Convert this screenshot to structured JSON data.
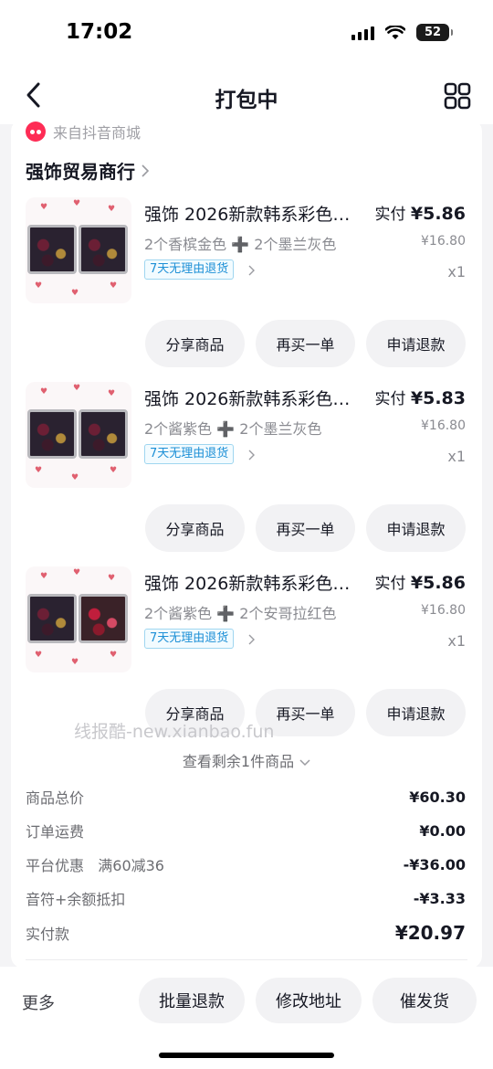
{
  "status": {
    "time": "17:02",
    "battery": "52"
  },
  "nav": {
    "title": "打包中"
  },
  "source": {
    "label": "来自抖音商城"
  },
  "shop": {
    "name": "强饰贸易商行"
  },
  "items": [
    {
      "title": "强饰 2026新款韩系彩色…",
      "spec": "2个香槟金色 ➕ 2个墨兰灰色",
      "tag": "7天无理由退货",
      "paid_label": "实付",
      "paid_price": "¥5.86",
      "orig_price": "¥16.80",
      "qty": "x1",
      "buttons": [
        "分享商品",
        "再买一单",
        "申请退款"
      ]
    },
    {
      "title": "强饰 2026新款韩系彩色…",
      "spec": "2个酱紫色 ➕ 2个墨兰灰色",
      "tag": "7天无理由退货",
      "paid_label": "实付",
      "paid_price": "¥5.83",
      "orig_price": "¥16.80",
      "qty": "x1",
      "buttons": [
        "分享商品",
        "再买一单",
        "申请退款"
      ]
    },
    {
      "title": "强饰 2026新款韩系彩色…",
      "spec": "2个酱紫色 ➕ 2个安哥拉红色",
      "tag": "7天无理由退货",
      "paid_label": "实付",
      "paid_price": "¥5.86",
      "orig_price": "¥16.80",
      "qty": "x1",
      "buttons": [
        "分享商品",
        "再买一单",
        "申请退款"
      ]
    }
  ],
  "watermark": "线报酷-new.xianbao.fun",
  "show_more": "查看剩余1件商品",
  "summary": [
    {
      "label": "商品总价",
      "value": "¥60.30"
    },
    {
      "label": "订单运费",
      "value": "¥0.00"
    },
    {
      "label": "平台优惠   满60减36",
      "value": "-¥36.00"
    },
    {
      "label": "音符+余额抵扣",
      "value": "-¥3.33"
    },
    {
      "label": "实付款",
      "value": "¥20.97"
    }
  ],
  "bottom": {
    "more": "更多",
    "buttons": [
      "批量退款",
      "修改地址",
      "催发货"
    ]
  }
}
